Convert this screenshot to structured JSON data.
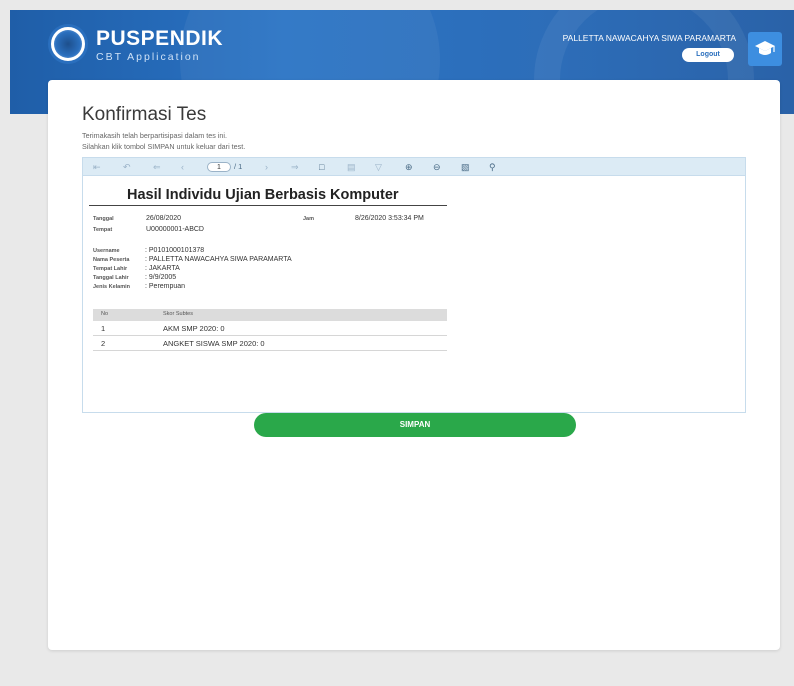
{
  "header": {
    "brand": "PUSPENDIK",
    "subtitle": "CBT Application",
    "user_name": "PALLETTA NAWACAHYA SIWA PARAMARTA",
    "logout_label": "Logout"
  },
  "page": {
    "title": "Konfirmasi Tes",
    "line1": "Terimakasih telah berpartisipasi dalam tes ini.",
    "line2": "Silahkan klik tombol SIMPAN untuk keluar dari test."
  },
  "viewer": {
    "page_current": "1",
    "page_total": "/ 1",
    "toolbar_icons": [
      "first-page-icon",
      "prev-page-icon",
      "prev-icon",
      "prev-small-icon",
      "next-small-icon",
      "next-page-icon",
      "page-icon",
      "export-icon",
      "filter-icon",
      "zoom-in-icon",
      "zoom-out-icon",
      "print-icon",
      "search-icon"
    ]
  },
  "report": {
    "title": "Hasil Individu Ujian Berbasis Komputer",
    "tanggal_label": "Tanggal",
    "tanggal": "26/08/2020",
    "tempat_label": "Tempat",
    "tempat": "U00000001-ABCD",
    "jam_label": "Jam",
    "jam": "8/26/2020 3:53:34 PM",
    "username_label": "Username",
    "username": ": P0101000101378",
    "nama_label": "Nama Peserta",
    "nama": ": PALLETTA NAWACAHYA SIWA PARAMARTA",
    "tempat_lahir_label": "Tempat Lahir",
    "tempat_lahir": ": JAKARTA",
    "tanggal_lahir_label": "Tanggal Lahir",
    "tanggal_lahir": ": 9/9/2005",
    "jenis_kelamin_label": "Jenis Kelamin",
    "jenis_kelamin": ": Perempuan",
    "table": {
      "headers": [
        "No",
        "Skor Subtes"
      ],
      "rows": [
        {
          "no": "1",
          "skor": "AKM SMP 2020: 0"
        },
        {
          "no": "2",
          "skor": "ANGKET SISWA SMP 2020: 0"
        }
      ]
    }
  },
  "actions": {
    "save_label": "SIMPAN"
  },
  "colors": {
    "header_blue": "#2a73c4",
    "save_green": "#2aa84a",
    "toolbar_bg": "#dcebf5"
  }
}
